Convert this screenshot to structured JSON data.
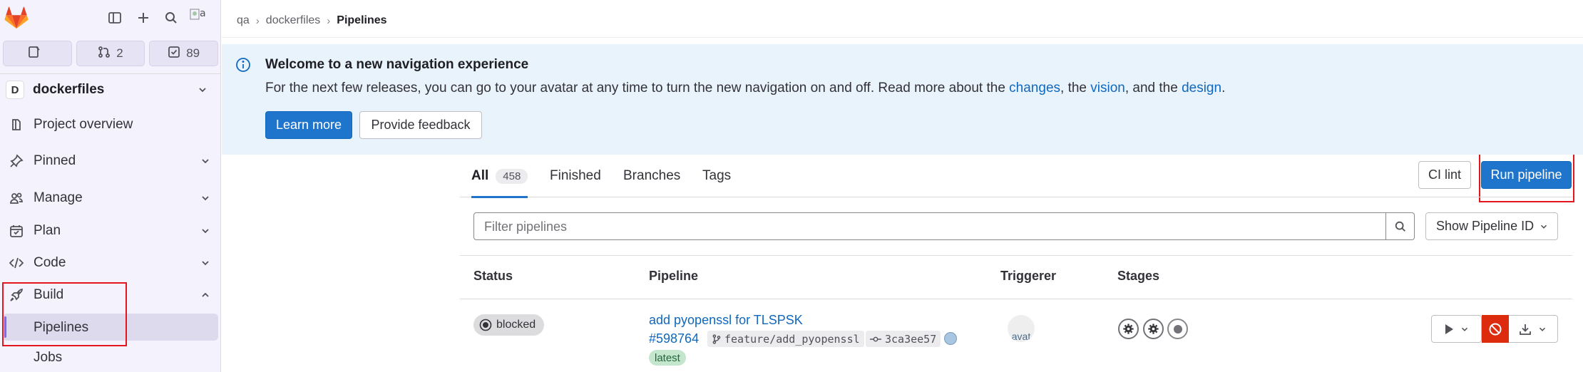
{
  "sidebar": {
    "counters": {
      "issues": "",
      "merge_requests": "2",
      "todos": "89"
    },
    "project": {
      "initial": "D",
      "name": "dockerfiles"
    },
    "items": [
      {
        "label": "Project overview"
      },
      {
        "label": "Pinned"
      },
      {
        "label": "Manage"
      },
      {
        "label": "Plan"
      },
      {
        "label": "Code"
      },
      {
        "label": "Build"
      }
    ],
    "sub_items": [
      {
        "label": "Pipelines"
      },
      {
        "label": "Jobs"
      }
    ],
    "avatar_alt": "a"
  },
  "breadcrumb": {
    "items": [
      "qa",
      "dockerfiles"
    ],
    "current": "Pipelines"
  },
  "banner": {
    "title": "Welcome to a new navigation experience",
    "text_1": "For the next few releases, you can go to your avatar at any time to turn the new navigation on and off. Read more about the ",
    "link_changes": "changes",
    "text_2": ", the ",
    "link_vision": "vision",
    "text_3": ", and the ",
    "link_design": "design",
    "text_4": ".",
    "learn_more": "Learn more",
    "provide_feedback": "Provide feedback"
  },
  "tabs": {
    "all": "All",
    "all_count": "458",
    "finished": "Finished",
    "branches": "Branches",
    "tags": "Tags"
  },
  "toolbar": {
    "ci_lint": "CI lint",
    "run_pipeline": "Run pipeline"
  },
  "filter": {
    "placeholder": "Filter pipelines",
    "select_value": "Show Pipeline ID"
  },
  "table": {
    "headers": {
      "status": "Status",
      "pipeline": "Pipeline",
      "triggerer": "Triggerer",
      "stages": "Stages"
    },
    "rows": [
      {
        "status": "blocked",
        "title": "add pyopenssl for TLSPSK",
        "id": "#598764",
        "branch": "feature/add_pyopenssl",
        "commit": "3ca3ee57",
        "badge": "latest",
        "triggerer_alt": "avat"
      }
    ]
  },
  "colors": {
    "primary": "#1f75cb",
    "danger": "#dd2b0e",
    "sidebar_bg": "#f3f2fd",
    "banner_bg": "#e9f3fc",
    "highlight": "#e3151f"
  }
}
